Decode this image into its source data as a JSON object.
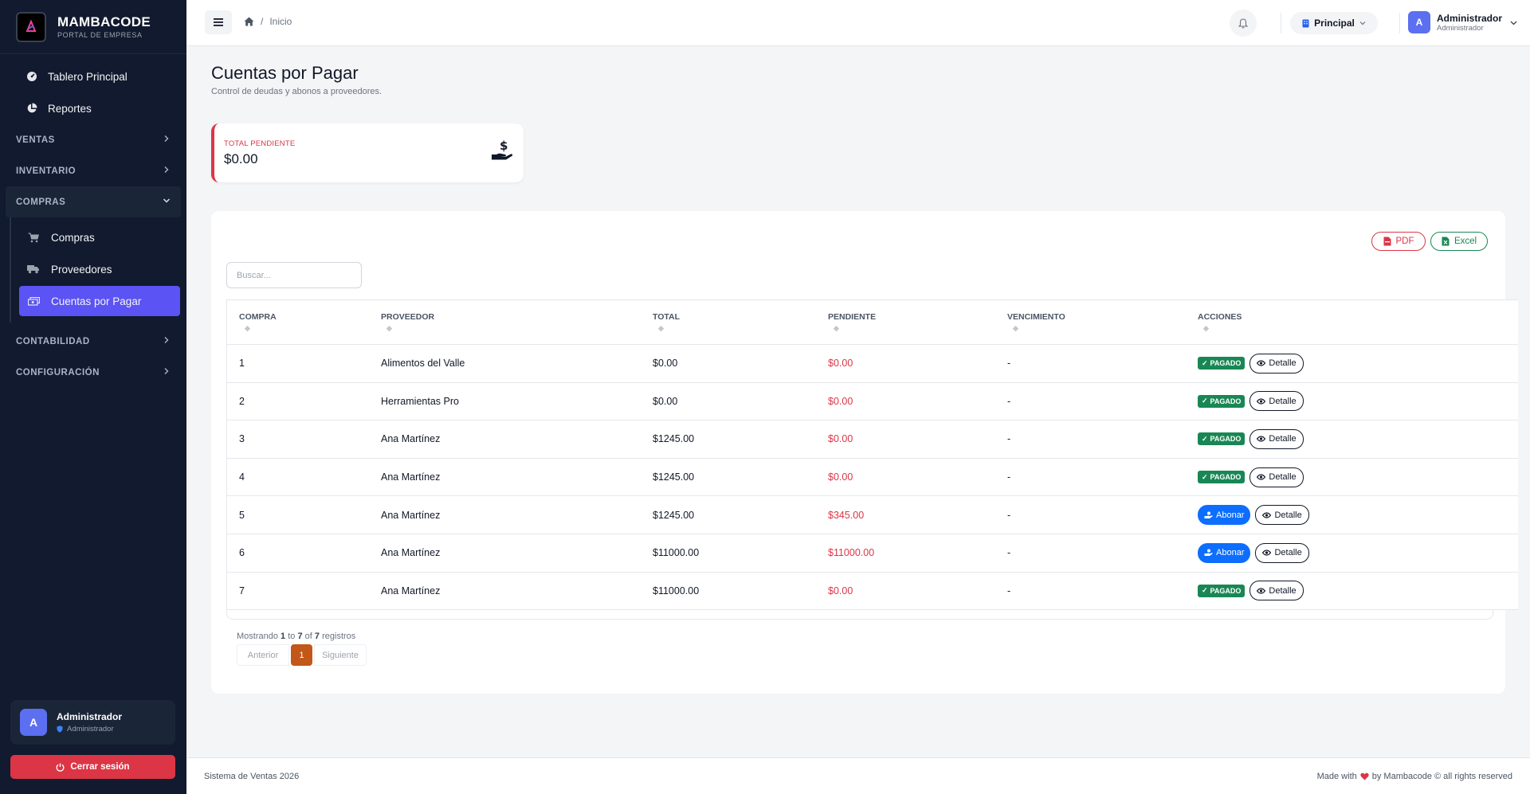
{
  "brand": {
    "name": "MAMBACODE",
    "subtitle": "PORTAL DE EMPRESA"
  },
  "sidebar": {
    "top_links": [
      {
        "label": "Tablero Principal",
        "icon": "gauge-icon"
      },
      {
        "label": "Reportes",
        "icon": "pie-chart-icon"
      }
    ],
    "sections": {
      "ventas": "VENTAS",
      "inventario": "INVENTARIO",
      "compras": "COMPRAS",
      "contabilidad": "CONTABILIDAD",
      "configuracion": "CONFIGURACIÓN"
    },
    "compras_items": [
      {
        "label": "Compras",
        "icon": "cart-icon"
      },
      {
        "label": "Proveedores",
        "icon": "truck-icon"
      },
      {
        "label": "Cuentas por Pagar",
        "icon": "money-bill-icon",
        "active": true
      }
    ],
    "user": {
      "initial": "A",
      "name": "Administrador",
      "role": "Administrador"
    },
    "logout_label": "Cerrar sesión"
  },
  "topbar": {
    "breadcrumb": "Inicio",
    "branch": "Principal",
    "user": {
      "initial": "A",
      "name": "Administrador",
      "role": "Administrador"
    }
  },
  "page": {
    "title": "Cuentas por Pagar",
    "subtitle": "Control de deudas y abonos a proveedores."
  },
  "stat": {
    "label": "TOTAL PENDIENTE",
    "value": "$0.00"
  },
  "exports": {
    "pdf": "PDF",
    "excel": "Excel"
  },
  "search": {
    "placeholder": "Buscar...",
    "value": ""
  },
  "table": {
    "headers": [
      "COMPRA",
      "PROVEEDOR",
      "TOTAL",
      "PENDIENTE",
      "VENCIMIENTO",
      "ACCIONES"
    ],
    "paid_label": "PAGADO",
    "detail_label": "Detalle",
    "pay_label": "Abonar",
    "rows": [
      {
        "compra": "1",
        "proveedor": "Alimentos del Valle",
        "total": "$0.00",
        "pendiente": "$0.00",
        "vencimiento": "-",
        "status": "paid"
      },
      {
        "compra": "2",
        "proveedor": "Herramientas Pro",
        "total": "$0.00",
        "pendiente": "$0.00",
        "vencimiento": "-",
        "status": "paid"
      },
      {
        "compra": "3",
        "proveedor": "Ana Martínez",
        "total": "$1245.00",
        "pendiente": "$0.00",
        "vencimiento": "-",
        "status": "paid"
      },
      {
        "compra": "4",
        "proveedor": "Ana Martínez",
        "total": "$1245.00",
        "pendiente": "$0.00",
        "vencimiento": "-",
        "status": "paid"
      },
      {
        "compra": "5",
        "proveedor": "Ana Martínez",
        "total": "$1245.00",
        "pendiente": "$345.00",
        "vencimiento": "-",
        "status": "pending"
      },
      {
        "compra": "6",
        "proveedor": "Ana Martínez",
        "total": "$11000.00",
        "pendiente": "$11000.00",
        "vencimiento": "-",
        "status": "pending"
      },
      {
        "compra": "7",
        "proveedor": "Ana Martínez",
        "total": "$11000.00",
        "pendiente": "$0.00",
        "vencimiento": "-",
        "status": "paid"
      }
    ]
  },
  "pagination": {
    "info_prefix": "Mostrando",
    "from": "1",
    "to_word": "to",
    "to": "7",
    "of_word": "of",
    "total": "7",
    "suffix": "registros",
    "prev": "Anterior",
    "current": "1",
    "next": "Siguiente"
  },
  "footer": {
    "left": "Sistema de Ventas 2026",
    "made_with": "Made with",
    "by": "by Mambacode © all rights reserved"
  },
  "colors": {
    "accent": "#5b53f3",
    "danger": "#dc3545",
    "success": "#198754",
    "primary": "#0d6efd",
    "page_current": "#c2571a"
  }
}
